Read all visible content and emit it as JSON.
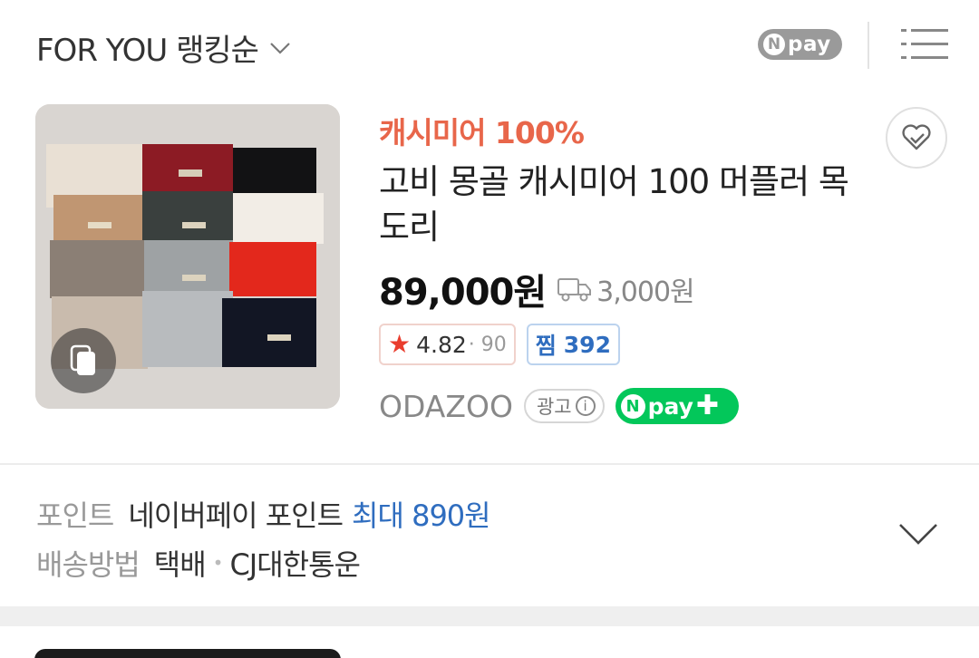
{
  "header": {
    "sort_label": "FOR YOU 랭킹순",
    "npay_n": "N",
    "npay_text": "pay",
    "icons": {
      "sort_chevron": "chevron-down-icon",
      "menu": "list-view-icon"
    }
  },
  "product": {
    "promo": "캐시미어 100%",
    "title": "고비 몽골 캐시미어 100 머플러 목도리",
    "price": "89,000원",
    "shipping": "3,000원",
    "rating_star": "★",
    "rating": "4.82",
    "rating_count": "· 90",
    "wish_label": "찜",
    "wish_count": "392",
    "seller": "ODAZOO",
    "ad_label": "광고",
    "ad_info": "i",
    "npay_plus_n": "N",
    "npay_plus_text": "pay",
    "npay_plus_sign": "✚",
    "icons": {
      "truck": "truck-icon",
      "wish": "heart-check-icon",
      "multi": "multi-image-icon"
    }
  },
  "info": {
    "point_label": "포인트",
    "point_value": "네이버페이 포인트",
    "point_max": "최대 890원",
    "delivery_label": "배송방법",
    "delivery_value": "택배",
    "delivery_sep": "•",
    "delivery_carrier": "CJ대한통운"
  },
  "colors": {
    "promo": "#e8664a",
    "npay_green": "#03c75a",
    "accent_blue": "#2f6dbf",
    "star_red": "#e93d2e"
  }
}
